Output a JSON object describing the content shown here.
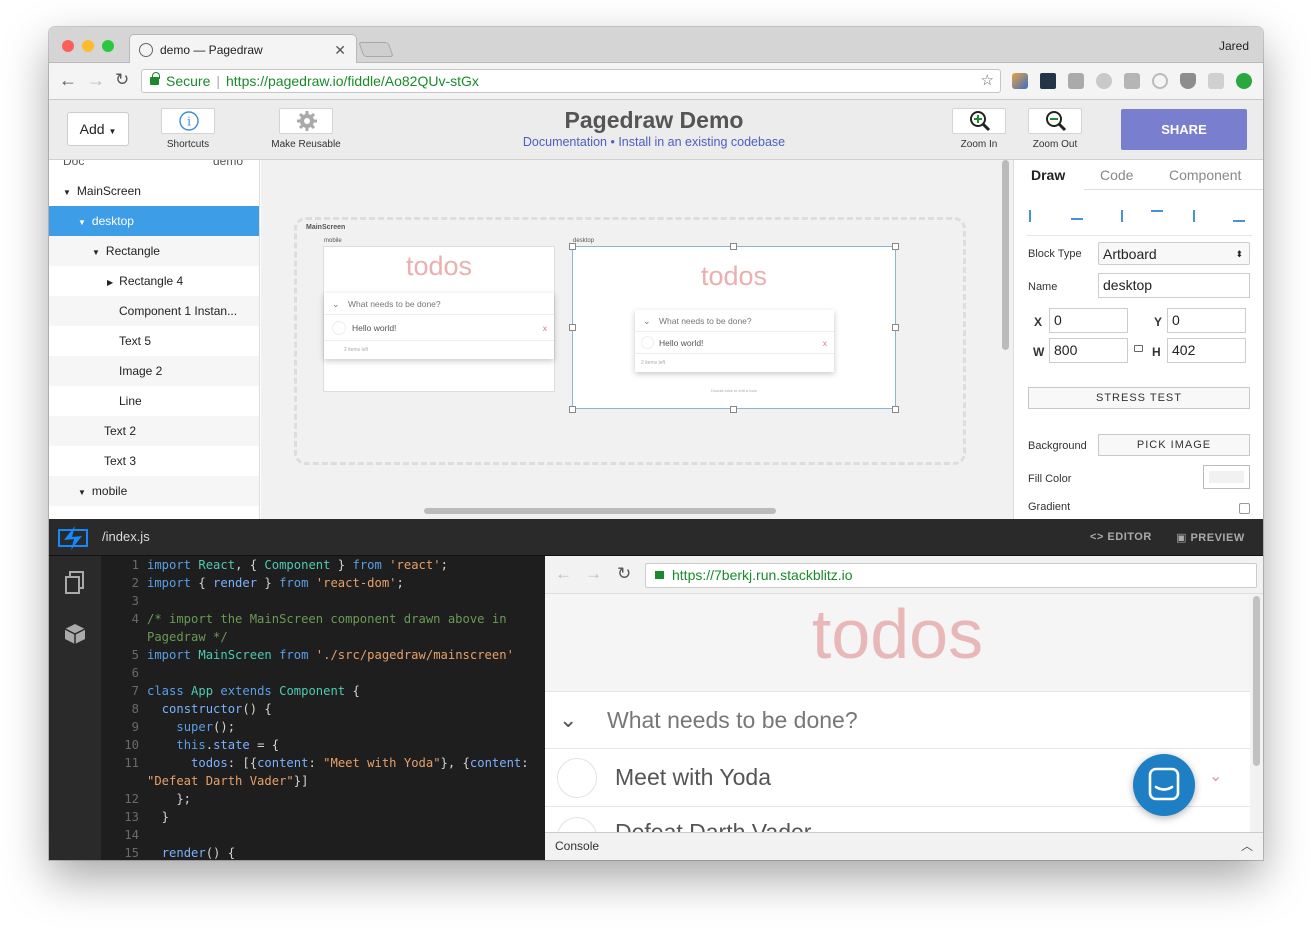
{
  "browser": {
    "tab_title": "demo — Pagedraw",
    "user": "Jared",
    "secure_label": "Secure",
    "url": "https://pagedraw.io/fiddle/Ao82QUv-stGx"
  },
  "toolbar": {
    "add_label": "Add",
    "shortcuts_label": "Shortcuts",
    "make_reusable_label": "Make Reusable",
    "title": "Pagedraw Demo",
    "doc_link": "Documentation",
    "bullet": "•",
    "install_link": "Install in an existing codebase",
    "zoom_in_label": "Zoom In",
    "zoom_out_label": "Zoom Out",
    "share_label": "SHARE"
  },
  "layers": {
    "header_left": "Doc",
    "header_right": "demo",
    "items": [
      {
        "label": "MainScreen"
      },
      {
        "label": "desktop"
      },
      {
        "label": "Rectangle"
      },
      {
        "label": "Rectangle 4"
      },
      {
        "label": "Component 1 Instan..."
      },
      {
        "label": "Text 5"
      },
      {
        "label": "Image 2"
      },
      {
        "label": "Line"
      },
      {
        "label": "Text 2"
      },
      {
        "label": "Text 3"
      },
      {
        "label": "mobile"
      }
    ]
  },
  "canvas": {
    "artboard_label": "MainScreen",
    "mobile_label": "mobile",
    "desktop_label": "desktop",
    "todos": "todos",
    "placeholder": "What needs to be done?",
    "item": "Hello world!",
    "items_left": "2 items left",
    "hint": "Double-click to edit a todo"
  },
  "inspector": {
    "tabs": [
      "Draw",
      "Code",
      "Component"
    ],
    "block_type_label": "Block Type",
    "block_type_value": "Artboard",
    "name_label": "Name",
    "name_value": "desktop",
    "x_label": "X",
    "x_value": "0",
    "y_label": "Y",
    "y_value": "0",
    "w_label": "W",
    "w_value": "800",
    "h_label": "H",
    "h_value": "402",
    "stress_test": "STRESS TEST",
    "background_label": "Background",
    "pick_image": "PICK IMAGE",
    "fill_color_label": "Fill Color",
    "gradient_label": "Gradient"
  },
  "stackblitz": {
    "file": "/index.js",
    "editor_tab": "EDITOR",
    "preview_tab": "PREVIEW",
    "preview_url": "https://7berkj.run.stackblitz.io",
    "preview_todos": "todos",
    "preview_placeholder": "What needs to be done?",
    "preview_item1": "Meet with Yoda",
    "preview_item2": "Defeat Darth Vader",
    "console": "Console"
  }
}
